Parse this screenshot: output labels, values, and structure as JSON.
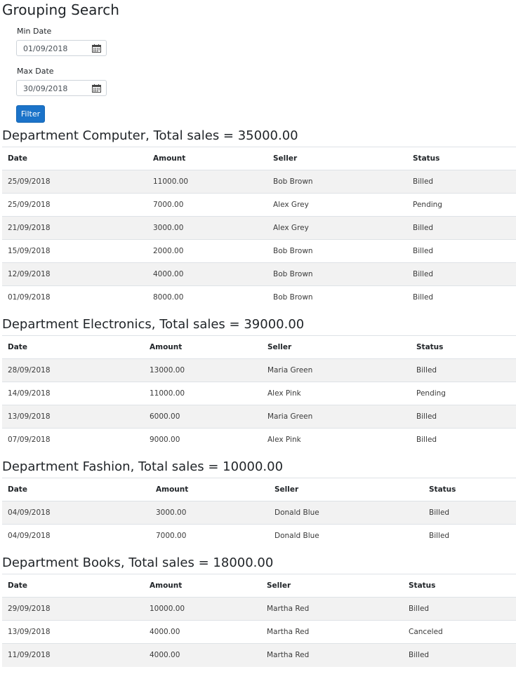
{
  "title": "Grouping Search",
  "filters": {
    "min_date": {
      "label": "Min Date",
      "value": "01/09/2018"
    },
    "max_date": {
      "label": "Max Date",
      "value": "30/09/2018"
    },
    "filter_button": "Filter"
  },
  "columns": [
    "Date",
    "Amount",
    "Seller",
    "Status"
  ],
  "departments": [
    {
      "heading": "Department Computer, Total sales = 35000.00",
      "rows": [
        [
          "25/09/2018",
          "11000.00",
          "Bob Brown",
          "Billed"
        ],
        [
          "25/09/2018",
          "7000.00",
          "Alex Grey",
          "Pending"
        ],
        [
          "21/09/2018",
          "3000.00",
          "Alex Grey",
          "Billed"
        ],
        [
          "15/09/2018",
          "2000.00",
          "Bob Brown",
          "Billed"
        ],
        [
          "12/09/2018",
          "4000.00",
          "Bob Brown",
          "Billed"
        ],
        [
          "01/09/2018",
          "8000.00",
          "Bob Brown",
          "Billed"
        ]
      ]
    },
    {
      "heading": "Department Electronics, Total sales = 39000.00",
      "rows": [
        [
          "28/09/2018",
          "13000.00",
          "Maria Green",
          "Billed"
        ],
        [
          "14/09/2018",
          "11000.00",
          "Alex Pink",
          "Pending"
        ],
        [
          "13/09/2018",
          "6000.00",
          "Maria Green",
          "Billed"
        ],
        [
          "07/09/2018",
          "9000.00",
          "Alex Pink",
          "Billed"
        ]
      ]
    },
    {
      "heading": "Department Fashion, Total sales = 10000.00",
      "rows": [
        [
          "04/09/2018",
          "3000.00",
          "Donald Blue",
          "Billed"
        ],
        [
          "04/09/2018",
          "7000.00",
          "Donald Blue",
          "Billed"
        ]
      ]
    },
    {
      "heading": "Department Books, Total sales = 18000.00",
      "rows": [
        [
          "29/09/2018",
          "10000.00",
          "Martha Red",
          "Billed"
        ],
        [
          "13/09/2018",
          "4000.00",
          "Martha Red",
          "Canceled"
        ],
        [
          "11/09/2018",
          "4000.00",
          "Martha Red",
          "Billed"
        ]
      ]
    }
  ]
}
